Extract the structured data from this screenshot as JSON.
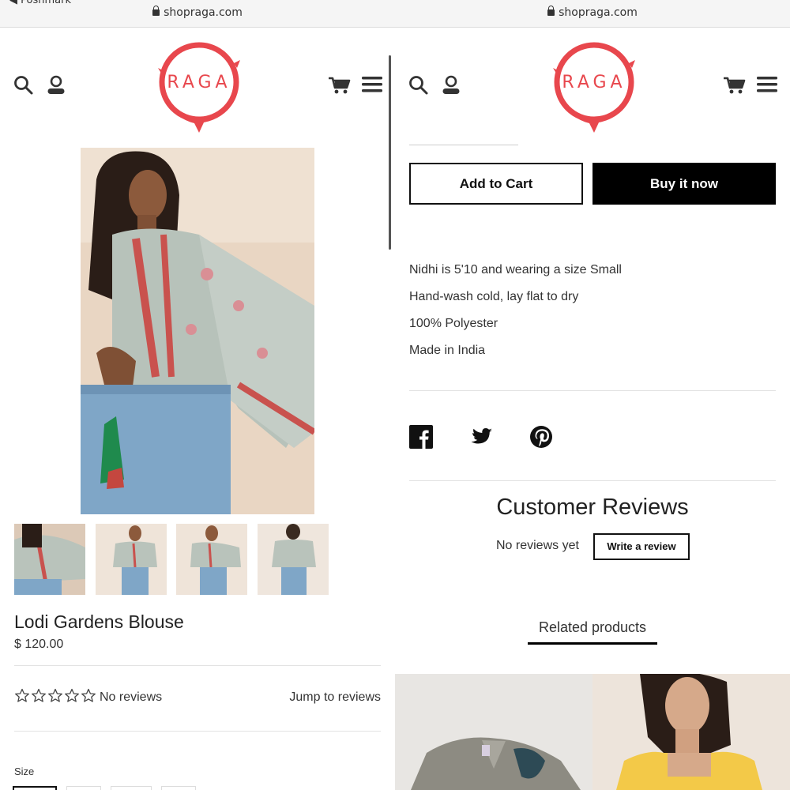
{
  "browser": {
    "back_label": "◀ Poshmark",
    "url": "shopraga.com"
  },
  "header": {
    "logo_text": "RAGA"
  },
  "product": {
    "title": "Lodi Gardens Blouse",
    "price": "$ 120.00",
    "reviews_summary": "No reviews",
    "jump_to_reviews": "Jump to reviews",
    "size_label": "Size"
  },
  "purchase": {
    "add_to_cart": "Add to Cart",
    "buy_now": "Buy it now"
  },
  "details": [
    "Nidhi is 5'10 and wearing a size Small",
    "Hand-wash cold, lay flat to dry",
    "100% Polyester",
    "Made in India"
  ],
  "reviews": {
    "title": "Customer Reviews",
    "empty_text": "No reviews yet",
    "write_button": "Write a review"
  },
  "related": {
    "title": "Related products"
  },
  "colors": {
    "brand_red": "#e8474d",
    "button_black": "#000000"
  }
}
